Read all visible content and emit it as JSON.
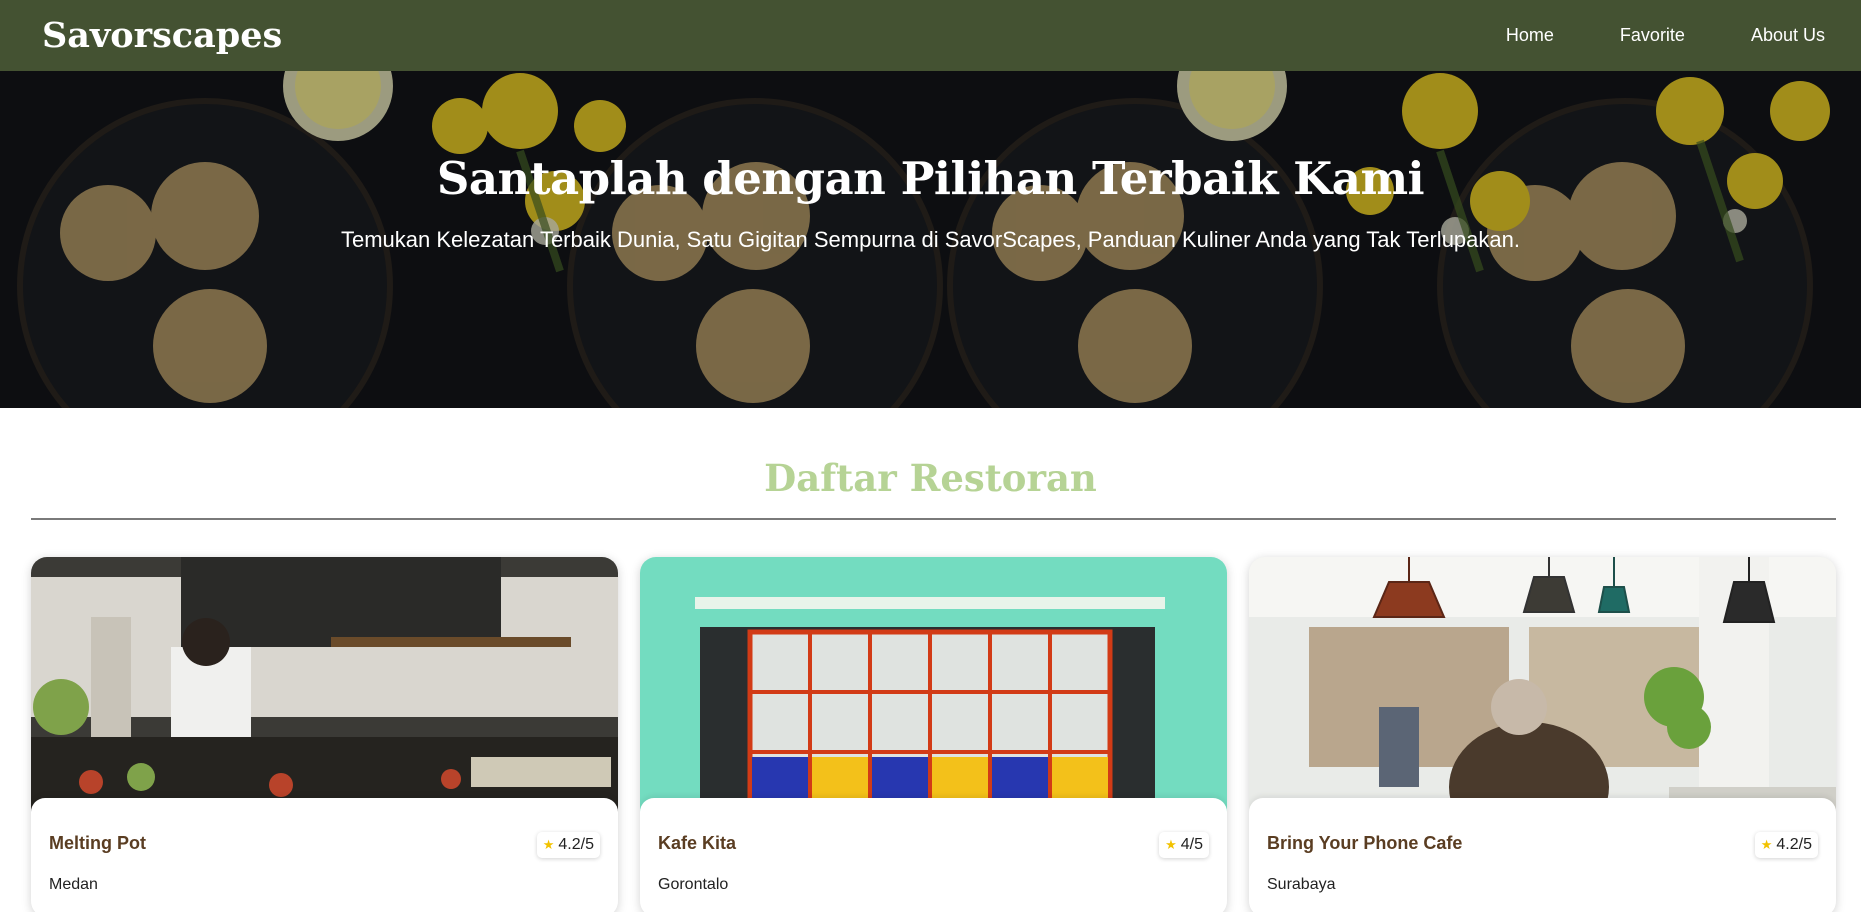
{
  "header": {
    "brand": "Savorscapes",
    "nav": [
      {
        "label": "Home"
      },
      {
        "label": "Favorite"
      },
      {
        "label": "About Us"
      }
    ]
  },
  "hero": {
    "title": "Santaplah dengan Pilihan Terbaik Kami",
    "subtitle": "Temukan Kelezatan Terbaik Dunia, Satu Gigitan Sempurna di SavorScapes, Panduan Kuliner Anda yang Tak Terlupakan."
  },
  "restaurants": {
    "heading": "Daftar Restoran",
    "items": [
      {
        "name": "Melting Pot",
        "city": "Medan",
        "rating": "4.2/5"
      },
      {
        "name": "Kafe Kita",
        "city": "Gorontalo",
        "rating": "4/5"
      },
      {
        "name": "Bring Your Phone Cafe",
        "city": "Surabaya",
        "rating": "4.2/5"
      }
    ]
  },
  "colors": {
    "navbar": "#445232",
    "section_heading": "#b6d395",
    "card_name": "#5a3d22",
    "star": "#f2c200"
  },
  "icons": {
    "rating": "star-icon"
  }
}
